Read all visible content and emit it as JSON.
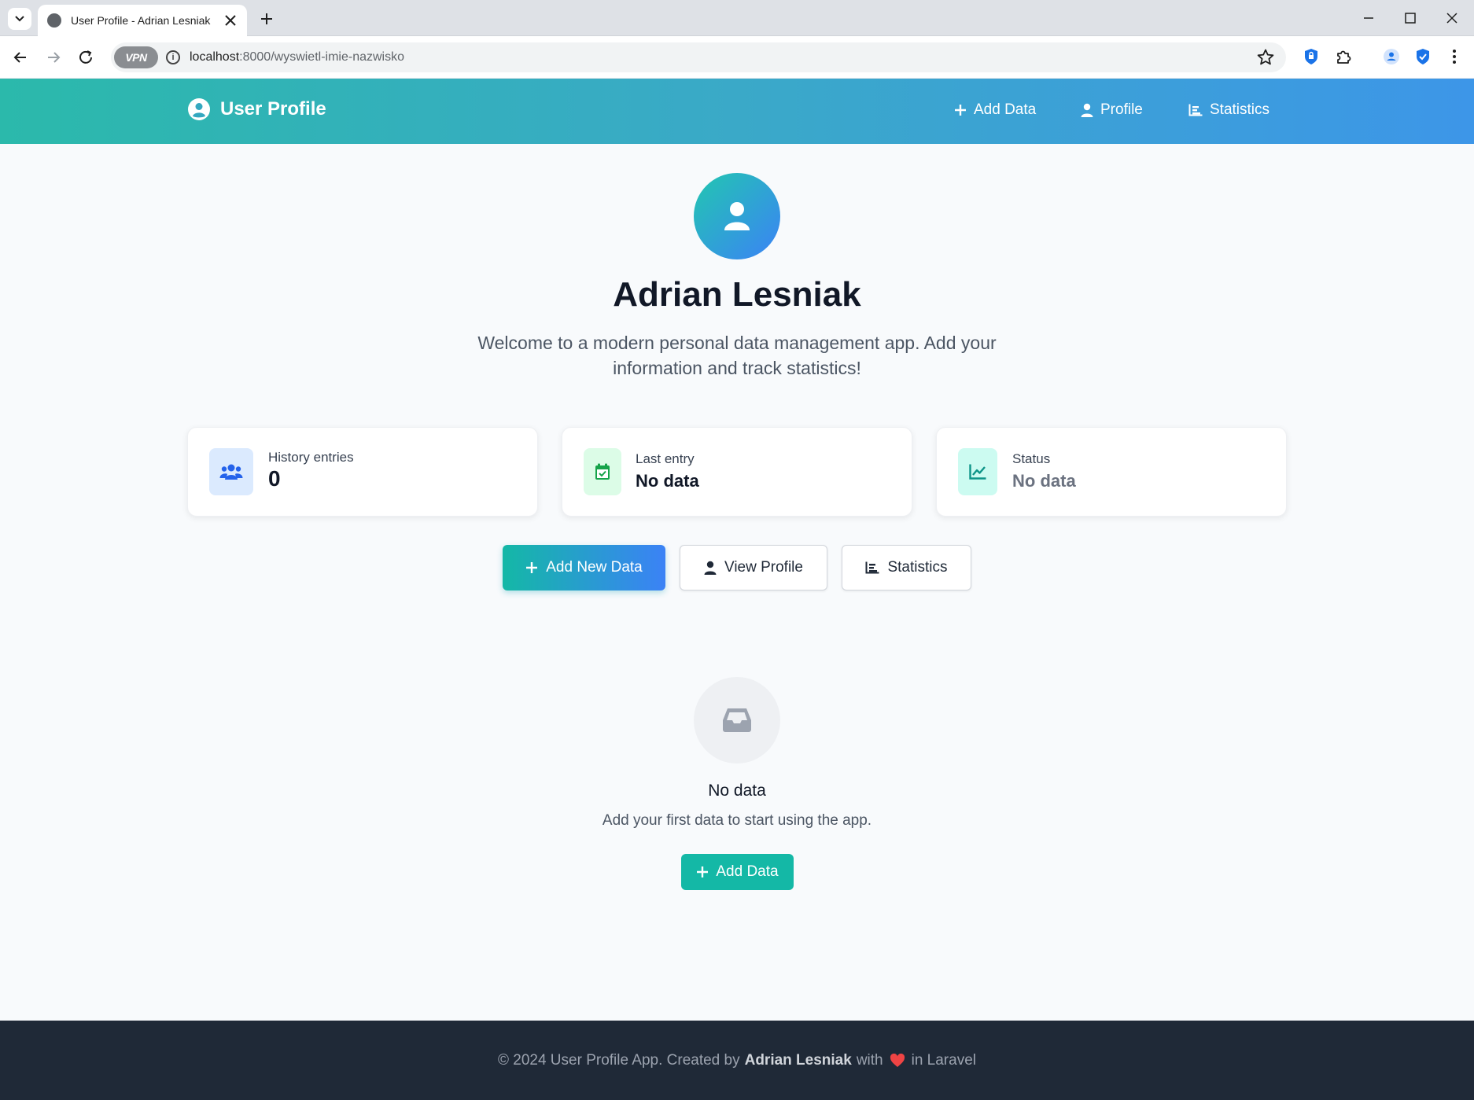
{
  "browser": {
    "tab_title": "User Profile - Adrian Lesniak",
    "url_host": "localhost",
    "url_path": ":8000/wyswietl-imie-nazwisko",
    "vpn_label": "VPN"
  },
  "header": {
    "brand": "User Profile",
    "nav": {
      "add_data": "Add Data",
      "profile": "Profile",
      "statistics": "Statistics"
    }
  },
  "hero": {
    "name": "Adrian Lesniak",
    "subtitle": "Welcome to a modern personal data management app. Add your information and track statistics!"
  },
  "stats": {
    "history": {
      "label": "History entries",
      "value": "0",
      "icon": "users-icon",
      "color": "#2563eb",
      "bg": "#dbeafe"
    },
    "last_entry": {
      "label": "Last entry",
      "value": "No data",
      "icon": "calendar-check-icon",
      "color": "#16a34a",
      "bg": "#dcfce7"
    },
    "status": {
      "label": "Status",
      "value": "No data",
      "icon": "chart-line-icon",
      "color": "#0d9488",
      "bg": "#ccfbf1"
    }
  },
  "actions": {
    "add_new": "Add New Data",
    "view_profile": "View Profile",
    "statistics": "Statistics"
  },
  "empty_state": {
    "title": "No data",
    "text": "Add your first data to start using the app.",
    "button": "Add Data"
  },
  "footer": {
    "prefix": "© 2024 User Profile App. Created by",
    "author": "Adrian Lesniak",
    "with": "with",
    "suffix": "in Laravel",
    "heart_color": "#ef4444"
  }
}
